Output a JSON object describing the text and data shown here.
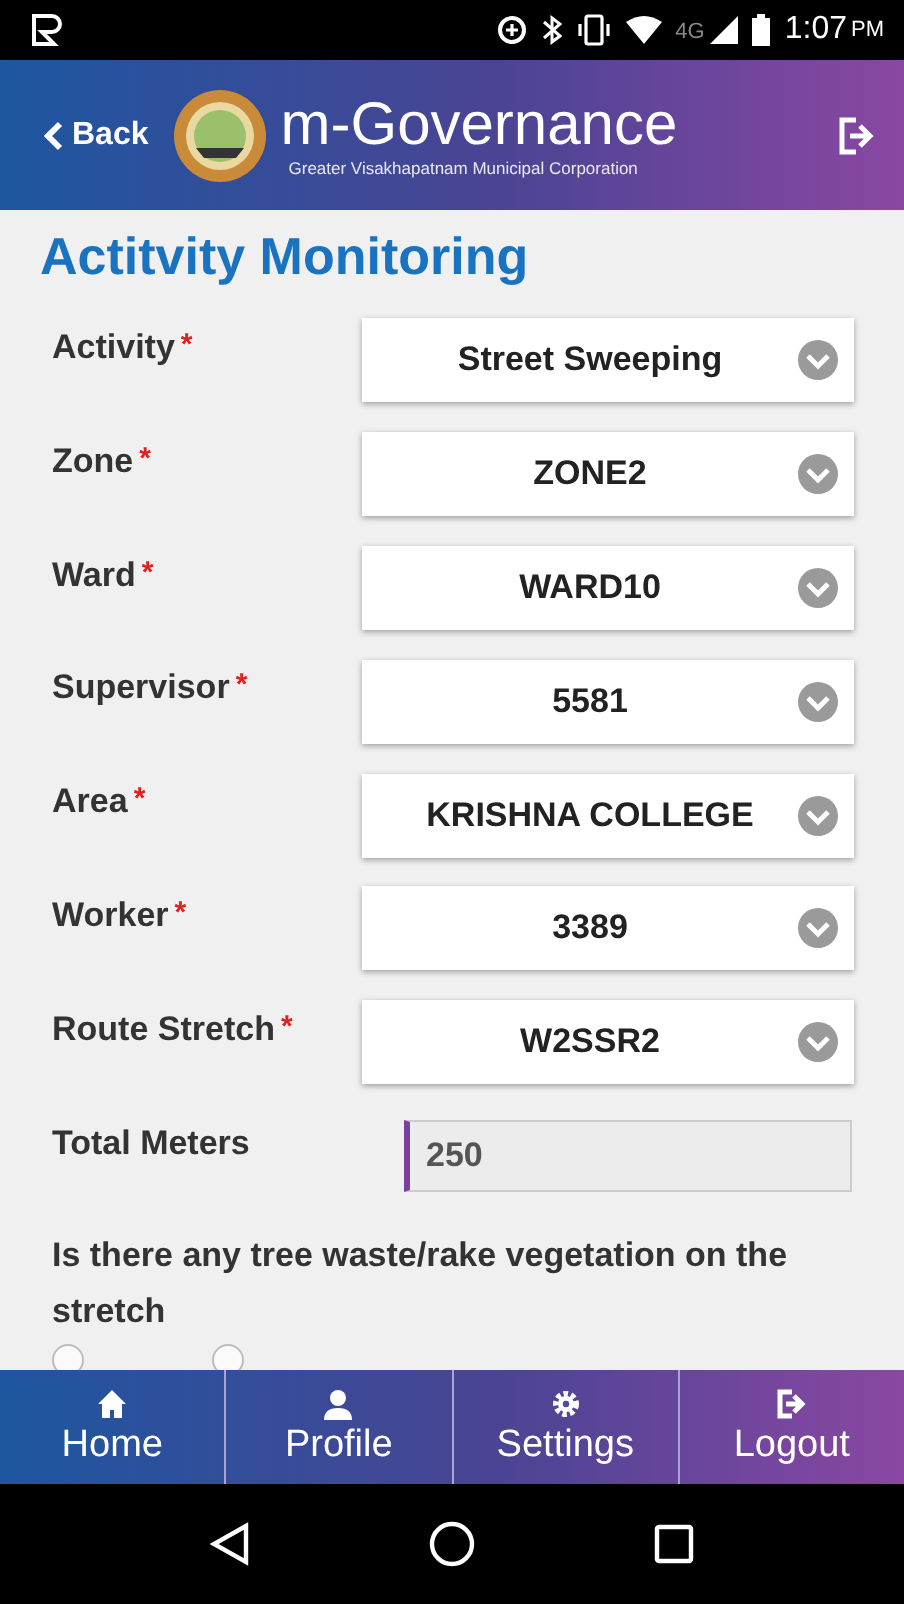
{
  "status_bar": {
    "time": "1:07",
    "am_pm": "PM",
    "network": "4G"
  },
  "header": {
    "back": "Back",
    "title": "m-Governance",
    "subtitle": "Greater Visakhapatnam Municipal Corporation"
  },
  "page_title": "Actitvity Monitoring",
  "fields": [
    {
      "kind": "select",
      "label": "Activity",
      "required_mark": "*",
      "value": "Street Sweeping"
    },
    {
      "kind": "select",
      "label": "Zone",
      "required_mark": "*",
      "value": "ZONE2"
    },
    {
      "kind": "select",
      "label": "Ward",
      "required_mark": "*",
      "value": "WARD10"
    },
    {
      "kind": "select",
      "label": "Supervisor",
      "required_mark": "*",
      "value": "5581"
    },
    {
      "kind": "select",
      "label": "Area",
      "required_mark": "*",
      "value": "KRISHNA COLLEGE"
    },
    {
      "kind": "select",
      "label": "Worker",
      "required_mark": "*",
      "value": "3389"
    },
    {
      "kind": "select",
      "label": "Route Stretch",
      "required_mark": "*",
      "value": "W2SSR2"
    },
    {
      "kind": "input",
      "label": "Total Meters",
      "value": "250"
    }
  ],
  "question": "Is there any tree waste/rake vegetation on the stretch",
  "radios": [
    {
      "selected": false
    },
    {
      "selected": false
    }
  ],
  "tabs": [
    {
      "kind": "home",
      "label": "Home"
    },
    {
      "kind": "profile",
      "label": "Profile"
    },
    {
      "kind": "settings",
      "label": "Settings"
    },
    {
      "kind": "logout",
      "label": "Logout"
    }
  ]
}
